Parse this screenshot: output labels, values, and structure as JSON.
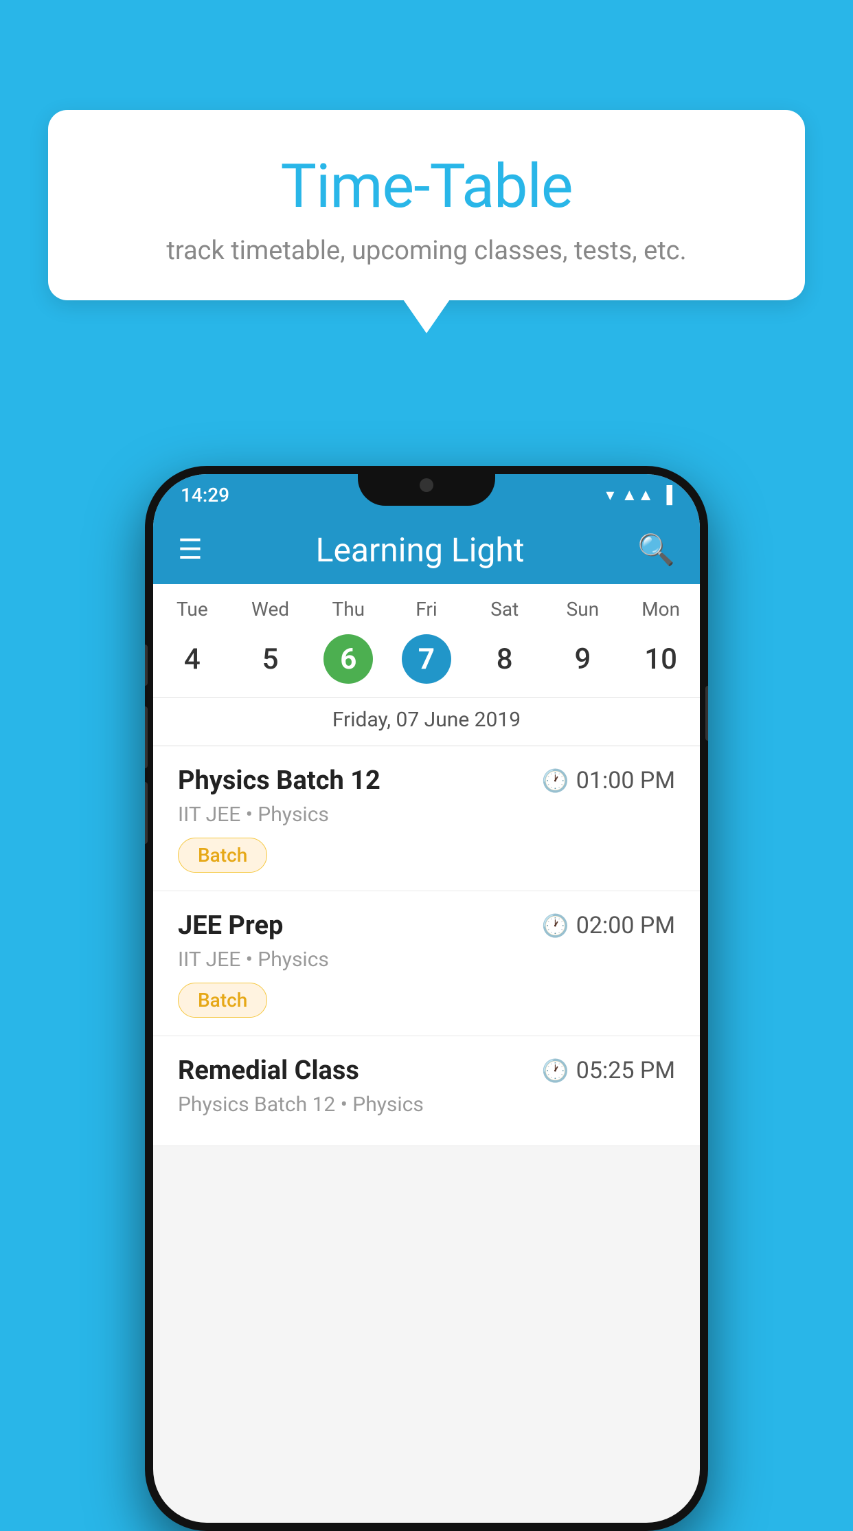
{
  "background_color": "#29b6e8",
  "bubble": {
    "title": "Time-Table",
    "subtitle": "track timetable, upcoming classes, tests, etc."
  },
  "phone": {
    "status_bar": {
      "time": "14:29"
    },
    "app_bar": {
      "title": "Learning Light"
    },
    "calendar": {
      "days": [
        {
          "label": "Tue",
          "num": "4"
        },
        {
          "label": "Wed",
          "num": "5"
        },
        {
          "label": "Thu",
          "num": "6",
          "state": "today"
        },
        {
          "label": "Fri",
          "num": "7",
          "state": "selected"
        },
        {
          "label": "Sat",
          "num": "8"
        },
        {
          "label": "Sun",
          "num": "9"
        },
        {
          "label": "Mon",
          "num": "10"
        }
      ],
      "selected_date_label": "Friday, 07 June 2019"
    },
    "classes": [
      {
        "name": "Physics Batch 12",
        "time": "01:00 PM",
        "meta": "IIT JEE • Physics",
        "tag": "Batch"
      },
      {
        "name": "JEE Prep",
        "time": "02:00 PM",
        "meta": "IIT JEE • Physics",
        "tag": "Batch"
      },
      {
        "name": "Remedial Class",
        "time": "05:25 PM",
        "meta": "Physics Batch 12 • Physics",
        "tag": ""
      }
    ]
  }
}
